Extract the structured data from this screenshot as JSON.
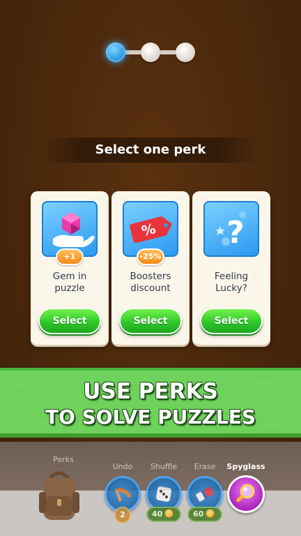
{
  "progress": {
    "total_steps": 3,
    "current_step": 1
  },
  "header": {
    "title": "Select one perk"
  },
  "perks": [
    {
      "title_line1": "Gem in",
      "title_line2": "puzzle",
      "badge": "+1",
      "button": "Select",
      "icon": "gem-in-hand-icon"
    },
    {
      "title_line1": "Boosters",
      "title_line2": "discount",
      "badge": "-25%",
      "button": "Select",
      "icon": "percent-tag-icon"
    },
    {
      "title_line1": "Feeling",
      "title_line2": "Lucky?",
      "badge": "",
      "button": "Select",
      "icon": "question-mark-icon"
    }
  ],
  "promo": {
    "line1": "USE PERKS",
    "line2": "TO SOLVE PUZZLES"
  },
  "toolbar": {
    "perks_label": "Perks",
    "tools": [
      {
        "label": "Undo",
        "icon": "boomerang-icon",
        "count": "2"
      },
      {
        "label": "Shuffle",
        "icon": "dice-icon",
        "cost": "40"
      },
      {
        "label": "Erase",
        "icon": "eraser-icon",
        "cost": "60"
      },
      {
        "label": "Spyglass",
        "icon": "magnifier-icon"
      }
    ]
  },
  "colors": {
    "accent_blue": "#2b9af0",
    "button_green": "#2fc82a",
    "badge_orange": "#f28a18",
    "banner_green": "#6fd25c",
    "spyglass_purple": "#a51ab8"
  }
}
